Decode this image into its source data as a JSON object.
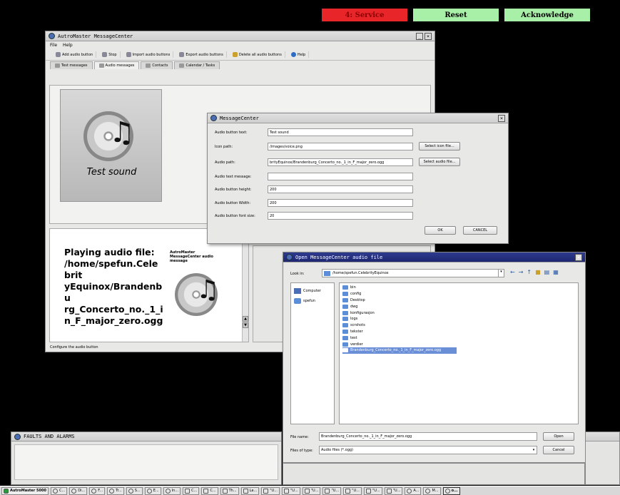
{
  "top_buttons": {
    "service": {
      "label": "4: Service",
      "color": "#e8262a"
    },
    "reset": {
      "label": "Reset",
      "color": "#a8f0a8"
    },
    "acknowledge": {
      "label": "Acknowledge",
      "color": "#a8f0a8"
    }
  },
  "main_window": {
    "title": "AutroMaster MessageCenter",
    "menu": [
      "File",
      "Help"
    ],
    "toolbar": [
      "Add audio button",
      "Stop",
      "Import audio buttons",
      "Export audio buttons",
      "Delete all audio buttons",
      "Help"
    ],
    "tabs": [
      "Test messages",
      "Audio messages",
      "Contacts",
      "Calendar / Tasks"
    ],
    "audio_button_label": "Test sound",
    "playing_text": "Playing audio file: /home/spefun.Celebrit yEquinox/Brandenbu rg_Concerto_no._1_i n_F_major_zero.ogg",
    "side_caption": "AutroMaster MessageCenter audio message",
    "status": "Configure the audio button"
  },
  "dialog": {
    "title": "MessageCenter",
    "fields": [
      {
        "label": "Audio button text:",
        "value": "Test sound"
      },
      {
        "label": "Icon path:",
        "value": "/images/voice.png"
      },
      {
        "label": "Audio path:",
        "value": "brityEquinox/Brandenburg_Concerto_no._1_in_F_major_zero.ogg"
      },
      {
        "label": "Audio text message:",
        "value": ""
      },
      {
        "label": "Audio button height:",
        "value": "200"
      },
      {
        "label": "Audio button Width:",
        "value": "200"
      },
      {
        "label": "Audio button font size:",
        "value": "20"
      }
    ],
    "select_icon": "Select icon file...",
    "select_audio": "Select audio file...",
    "ok": "OK",
    "cancel": "CANCEL"
  },
  "file_dialog": {
    "title": "Open MessageCenter audio file",
    "look_in_label": "Look in:",
    "look_in_value": "/home/spefun.CelebrityEquinox",
    "places": [
      "Computer",
      "spefun"
    ],
    "entries": [
      "bin",
      "config",
      "Desktop",
      "dwg",
      "konfigurasjon",
      "logs",
      "scrshots",
      "tekster",
      "test",
      "verdier",
      "Brandenburg_Concerto_no._1_in_F_major_zero.ogg"
    ],
    "file_name_label": "File name:",
    "file_name_value": "Brandenburg_Concerto_no._1_in_F_major_zero.ogg",
    "files_type_label": "Files of type:",
    "files_type_value": "Audio files (*.ogg)",
    "open": "Open",
    "cancel": "Cancel"
  },
  "faults": {
    "title": "FAULTS AND ALARMS"
  },
  "taskbar": {
    "start": "AutroMaster 5000",
    "items": [
      "C...",
      "Di...",
      "F...",
      "Tr...",
      "S...",
      "E...",
      "In...",
      "C...",
      "C...",
      "Th...",
      "La...",
      "\"U...",
      "\"U...",
      "\"U...",
      "\"U...",
      "\"U...",
      "\"U...",
      "\"U...",
      "A...",
      "M...",
      "o..."
    ]
  }
}
